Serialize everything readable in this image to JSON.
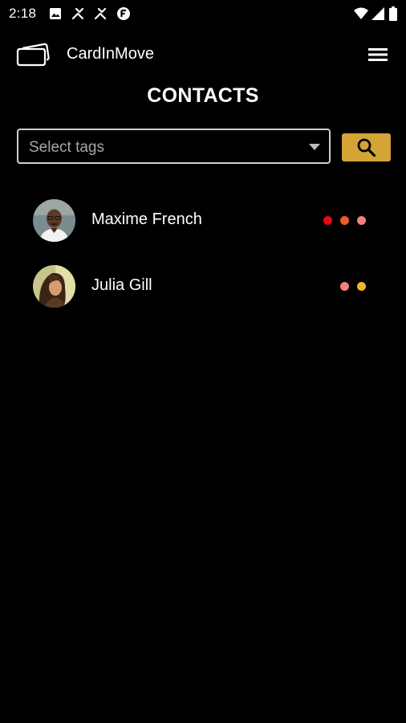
{
  "status_bar": {
    "time": "2:18",
    "left_icons": [
      "image-notification-icon",
      "tool-notification-icon",
      "tool-notification-icon",
      "round-logo-notification-icon"
    ],
    "right_icons": [
      "wifi-icon",
      "cellular-signal-icon",
      "battery-icon"
    ]
  },
  "header": {
    "app_name": "CardInMove",
    "logo_icon": "cards-logo-icon",
    "menu_icon": "hamburger-menu-icon"
  },
  "page": {
    "title": "CONTACTS"
  },
  "filter": {
    "placeholder": "Select tags",
    "dropdown_icon": "dropdown-arrow-icon",
    "search_icon": "search-icon",
    "search_button_color": "#d4a437"
  },
  "contacts": [
    {
      "name": "Maxime French",
      "avatar_icon": "avatar-photo",
      "tags": [
        "#e50914",
        "#f05a2a",
        "#f08080"
      ]
    },
    {
      "name": "Julia Gill",
      "avatar_icon": "avatar-photo",
      "tags": [
        "#f08080",
        "#f2b233"
      ]
    }
  ],
  "colors": {
    "background": "#000000",
    "text": "#ffffff",
    "accent": "#d4a437",
    "input_border": "#cfcfcf",
    "placeholder": "#a6a6a6"
  }
}
